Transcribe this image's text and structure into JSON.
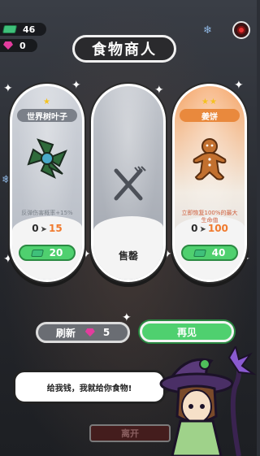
{
  "currency": {
    "cash": "46",
    "gems": "0"
  },
  "title": "食物商人",
  "cards": [
    {
      "stars": "★",
      "name": "世界树叶子",
      "description": "反弹伤害概率+15%",
      "level_from": "0",
      "level_to": "15",
      "price": "20"
    },
    {
      "sold_label": "售罄"
    },
    {
      "stars": "★★",
      "name": "姜饼",
      "description": "立即恢复100%的最大生命值",
      "level_from": "0",
      "level_to": "100",
      "price": "40"
    }
  ],
  "buttons": {
    "refresh_label": "刷新",
    "refresh_cost": "5",
    "bye_label": "再见"
  },
  "dialog": "给我钱，我就给你食物!",
  "bottom_bar_label": "离开",
  "colors": {
    "accent_green": "#4fd06f",
    "gem_pink": "#e23c9d",
    "card_orange": "#f6a86c"
  }
}
